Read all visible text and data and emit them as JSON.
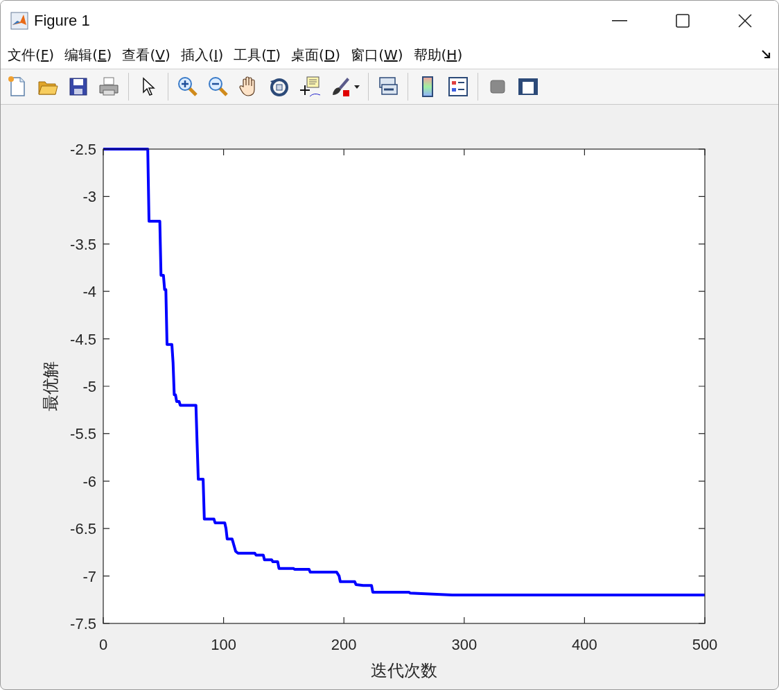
{
  "window": {
    "title": "Figure 1"
  },
  "menu": [
    {
      "prefix": "文件(",
      "key": "F",
      "suffix": ")"
    },
    {
      "prefix": "编辑(",
      "key": "E",
      "suffix": ")"
    },
    {
      "prefix": "查看(",
      "key": "V",
      "suffix": ")"
    },
    {
      "prefix": "插入(",
      "key": "I",
      "suffix": ")"
    },
    {
      "prefix": "工具(",
      "key": "T",
      "suffix": ")"
    },
    {
      "prefix": "桌面(",
      "key": "D",
      "suffix": ")"
    },
    {
      "prefix": "窗口(",
      "key": "W",
      "suffix": ")"
    },
    {
      "prefix": "帮助(",
      "key": "H",
      "suffix": ")"
    }
  ],
  "toolbar": [
    {
      "kind": "new"
    },
    {
      "kind": "open"
    },
    {
      "kind": "save"
    },
    {
      "kind": "print"
    },
    {
      "kind": "sep"
    },
    {
      "kind": "pointer"
    },
    {
      "kind": "sep"
    },
    {
      "kind": "zoomin"
    },
    {
      "kind": "zoomout"
    },
    {
      "kind": "pan"
    },
    {
      "kind": "rotate"
    },
    {
      "kind": "datatip"
    },
    {
      "kind": "brush"
    },
    {
      "kind": "sep"
    },
    {
      "kind": "link"
    },
    {
      "kind": "sep"
    },
    {
      "kind": "colorbar"
    },
    {
      "kind": "legend"
    },
    {
      "kind": "sep"
    },
    {
      "kind": "hidetools"
    },
    {
      "kind": "showtools"
    }
  ],
  "chart_data": {
    "type": "line",
    "xlabel": "迭代次数",
    "ylabel": "最优解",
    "xlim": [
      0,
      500
    ],
    "ylim": [
      -7.5,
      -2.5
    ],
    "xticks": [
      0,
      100,
      200,
      300,
      400,
      500
    ],
    "yticks": [
      -7.5,
      -7,
      -6.5,
      -6,
      -5.5,
      -5,
      -4.5,
      -4,
      -3.5,
      -3,
      -2.5
    ],
    "x": [
      0,
      37,
      38,
      47,
      48,
      50,
      51,
      52,
      53,
      57,
      58,
      59,
      60,
      61,
      63,
      64,
      77,
      78,
      79,
      83,
      84,
      92,
      93,
      101,
      102,
      103,
      107,
      108,
      110,
      112,
      126,
      127,
      133,
      134,
      140,
      141,
      145,
      146,
      158,
      159,
      171,
      172,
      194,
      196,
      197,
      209,
      210,
      216,
      223,
      224,
      254,
      255,
      290,
      500
    ],
    "series": [
      {
        "color": "#0000ff",
        "values": [
          -2.5,
          -2.5,
          -3.26,
          -3.26,
          -3.83,
          -3.83,
          -3.98,
          -3.98,
          -4.56,
          -4.56,
          -4.75,
          -5.09,
          -5.09,
          -5.16,
          -5.16,
          -5.2,
          -5.2,
          -5.6,
          -5.98,
          -5.98,
          -6.4,
          -6.4,
          -6.44,
          -6.44,
          -6.5,
          -6.61,
          -6.61,
          -6.65,
          -6.74,
          -6.76,
          -6.76,
          -6.78,
          -6.78,
          -6.83,
          -6.83,
          -6.85,
          -6.85,
          -6.92,
          -6.92,
          -6.93,
          -6.93,
          -6.96,
          -6.96,
          -7.0,
          -7.06,
          -7.06,
          -7.09,
          -7.1,
          -7.1,
          -7.17,
          -7.17,
          -7.18,
          -7.2,
          -7.2
        ]
      }
    ]
  }
}
